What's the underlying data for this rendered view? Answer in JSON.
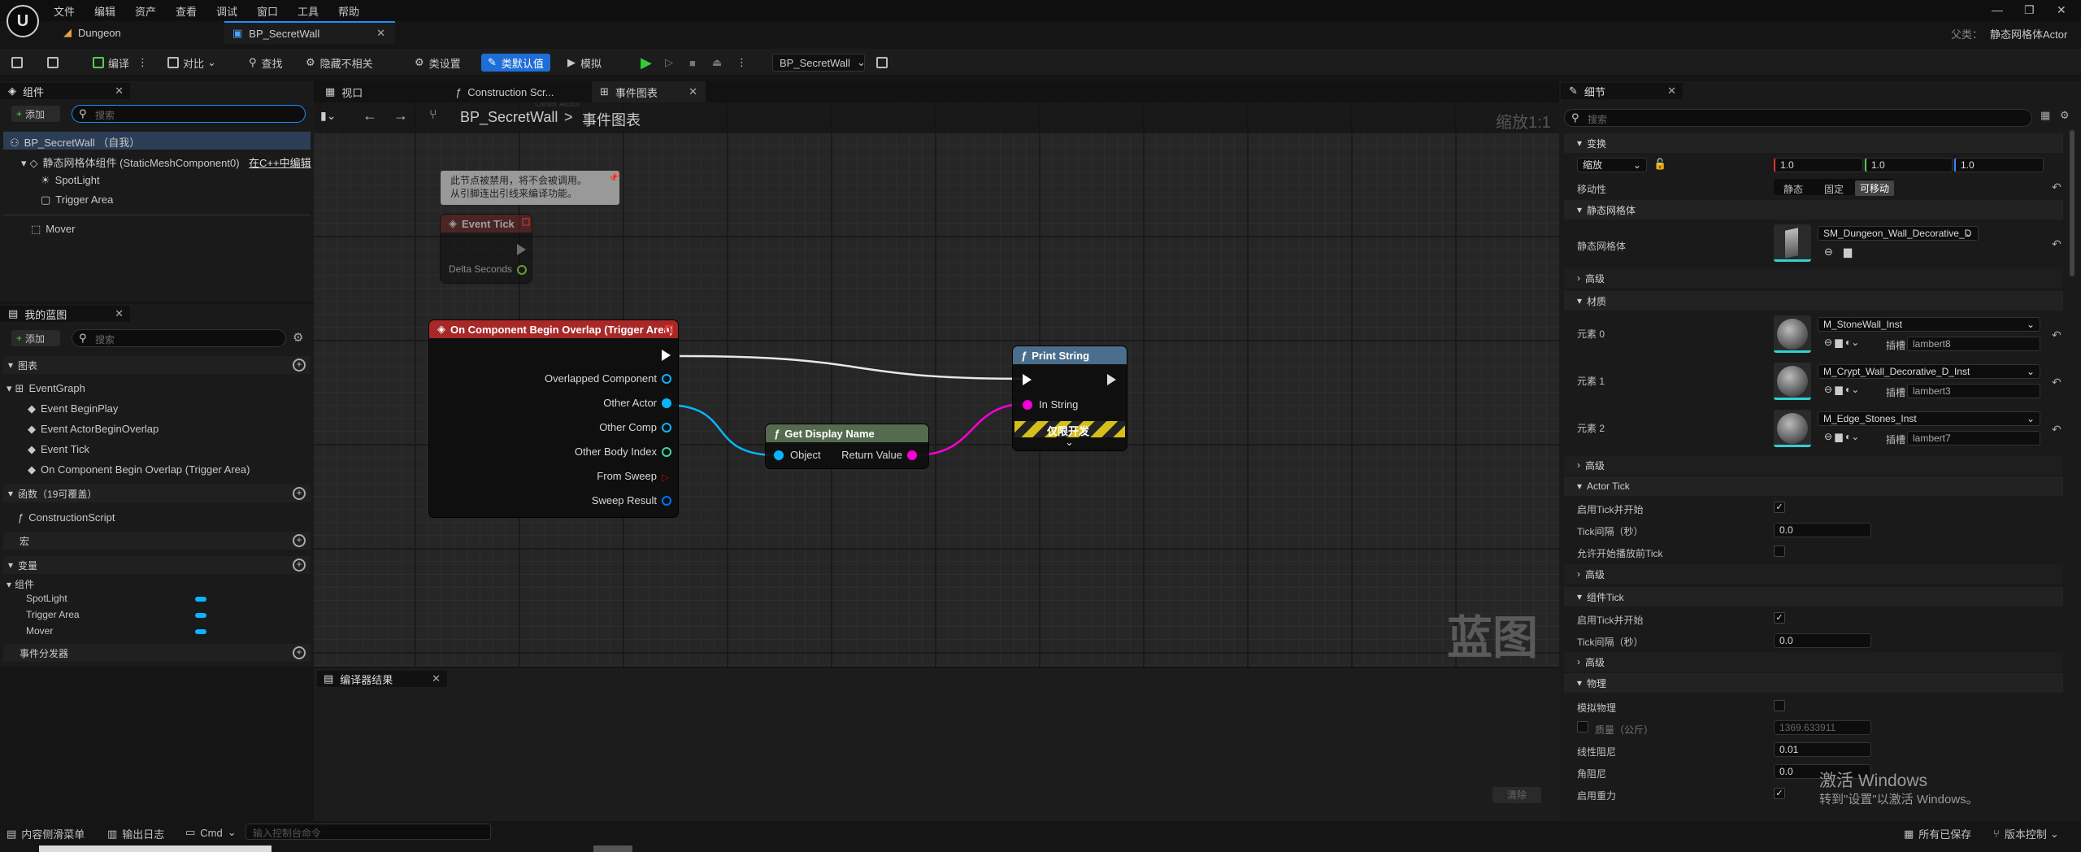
{
  "menu": [
    "文件",
    "编辑",
    "资产",
    "查看",
    "调试",
    "窗口",
    "工具",
    "帮助"
  ],
  "doc_tabs": [
    {
      "label": "Dungeon"
    },
    {
      "label": "BP_SecretWall"
    }
  ],
  "parent": {
    "label": "父类：",
    "value": "静态网格体Actor"
  },
  "toolbar": {
    "compile": "编译",
    "diff": "对比",
    "find": "查找",
    "hide_unrelated": "隐藏不相关",
    "class_settings": "类设置",
    "class_defaults": "类默认值",
    "simulate": "模拟",
    "debug_object": "BP_SecretWall"
  },
  "components_panel": {
    "title": "组件",
    "add": "添加",
    "search_placeholder": "搜索",
    "items": [
      "BP_SecretWall （自我）",
      "静态网格体组件 (StaticMeshComponent0)",
      "SpotLight",
      "Trigger Area",
      "Mover"
    ],
    "edit_in_cpp": "在C++中编辑"
  },
  "my_blueprint": {
    "title": "我的蓝图",
    "add": "添加",
    "search_placeholder": "搜索",
    "graphs_label": "图表",
    "event_graph": "EventGraph",
    "events": [
      "Event BeginPlay",
      "Event ActorBeginOverlap",
      "Event Tick",
      "On Component Begin Overlap (Trigger Area)"
    ],
    "functions_label": "函数（19可覆盖）",
    "construction_script": "ConstructionScript",
    "macros_label": "宏",
    "variables_label": "变量",
    "components_label": "组件",
    "variables": [
      "SpotLight",
      "Trigger Area",
      "Mover"
    ],
    "dispatchers_label": "事件分发器"
  },
  "graph_tabs": [
    "视口",
    "Construction Scr...",
    "事件图表"
  ],
  "breadcrumb": {
    "root": "BP_SecretWall",
    "sep": ">",
    "leaf": "事件图表"
  },
  "zoom": "缩放1:1",
  "watermark": "蓝图",
  "ghost_label": "Other Actor",
  "nodes": {
    "disabled_comment": "此节点被禁用，将不会被调用。\n从引脚连出引线来编译功能。",
    "event_tick": {
      "title": "Event Tick",
      "pin": "Delta Seconds"
    },
    "overlap": {
      "title": "On Component Begin Overlap (Trigger Area)",
      "pins": [
        "Overlapped Component",
        "Other Actor",
        "Other Comp",
        "Other Body Index",
        "From Sweep",
        "Sweep Result"
      ]
    },
    "get_display_name": {
      "title": "Get Display Name",
      "in": "Object",
      "out": "Return Value"
    },
    "print_string": {
      "title": "Print String",
      "in": "In String",
      "dev_only": "仅限开发"
    }
  },
  "compiler_results": {
    "title": "编译器结果",
    "clear": "清除"
  },
  "details": {
    "title": "细节",
    "search_placeholder": "搜索",
    "transform": "变换",
    "scale_label": "缩放",
    "scale": [
      "1.0",
      "1.0",
      "1.0"
    ],
    "mobility_label": "移动性",
    "mobility_options": [
      "静态",
      "固定",
      "可移动"
    ],
    "static_mesh_section": "静态网格体",
    "static_mesh_label": "静态网格体",
    "static_mesh_value": "SM_Dungeon_Wall_Decorative_D",
    "advanced": "高级",
    "materials_section": "材质",
    "materials": [
      {
        "label": "元素 0",
        "value": "M_StoneWall_Inst",
        "slot": "插槽",
        "slot_name": "lambert8"
      },
      {
        "label": "元素 1",
        "value": "M_Crypt_Wall_Decorative_D_Inst",
        "slot": "插槽",
        "slot_name": "lambert3"
      },
      {
        "label": "元素 2",
        "value": "M_Edge_Stones_Inst",
        "slot": "插槽",
        "slot_name": "lambert7"
      }
    ],
    "actor_tick_section": "Actor Tick",
    "start_tick": "启用Tick并开始",
    "tick_interval": "Tick间隔（秒）",
    "tick_interval_value": "0.0",
    "allow_tick_before_play": "允许开始播放前Tick",
    "component_tick_section": "组件Tick",
    "physics_section": "物理",
    "simulate_physics": "模拟物理",
    "mass": "质量（公斤）",
    "mass_value": "1369.633911",
    "linear_damping": "线性阻尼",
    "linear_damping_value": "0.01",
    "angular_damping": "角阻尼",
    "angular_damping_value": "0.0",
    "enable_gravity": "启用重力"
  },
  "activate_windows": {
    "line1": "激活 Windows",
    "line2": "转到\"设置\"以激活 Windows。"
  },
  "statusbar": {
    "content_drawer": "内容侧滑菜单",
    "output_log": "输出日志",
    "cmd": "Cmd",
    "cmd_placeholder": "输入控制台命令",
    "all_saved": "所有已保存",
    "version_control": "版本控制"
  },
  "colors": {
    "accent": "#1e8dff",
    "event_red": "#a82828",
    "function_blue": "#4a6e8c",
    "pure_green": "#556b4f",
    "object_pin": "#0ab4ff",
    "string_pin": "#f500d8"
  }
}
